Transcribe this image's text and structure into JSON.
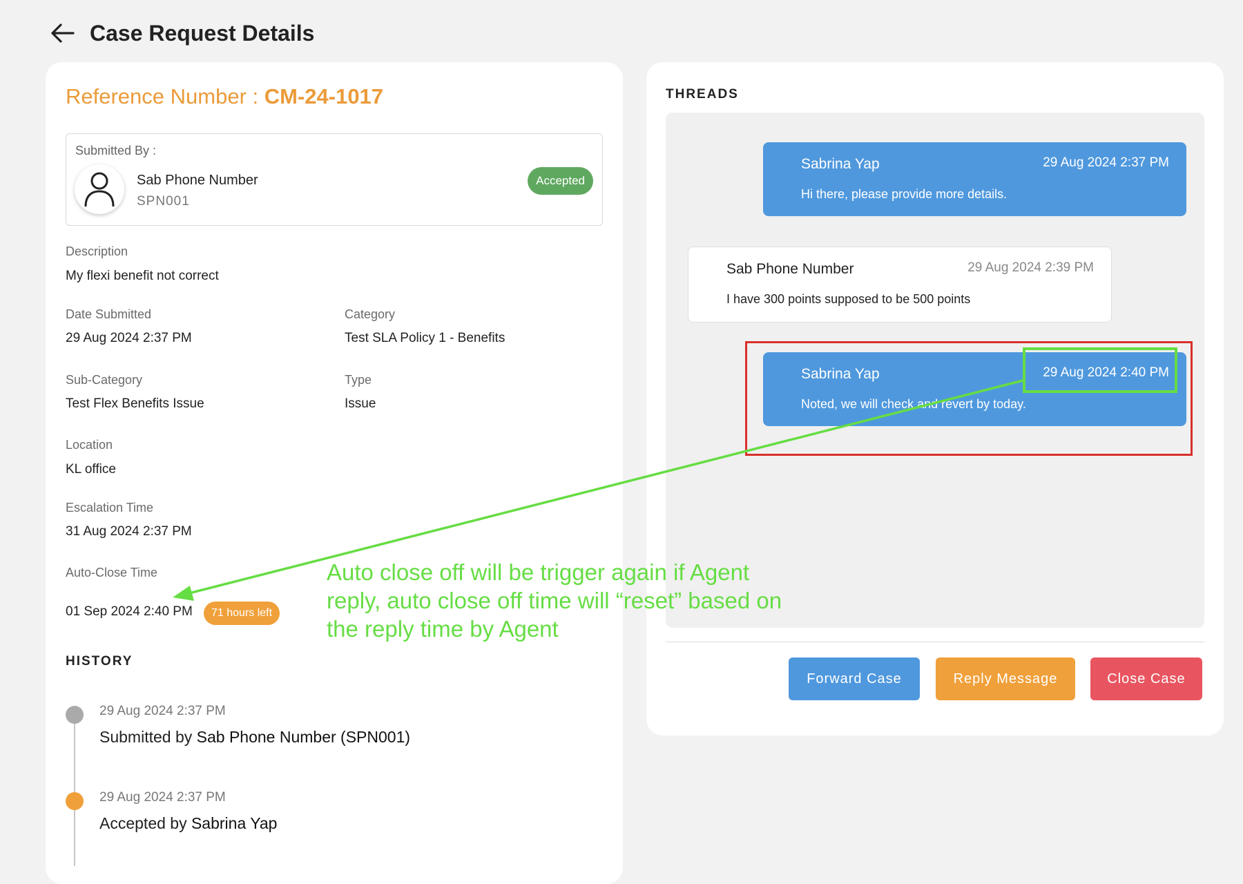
{
  "header": {
    "title": "Case Request Details"
  },
  "reference": {
    "label": "Reference Number : ",
    "number": "CM-24-1017"
  },
  "submitted_by": {
    "label": "Submitted By :",
    "name": "Sab Phone Number",
    "id": "SPN001",
    "status": "Accepted"
  },
  "details": {
    "description_label": "Description",
    "description": "My flexi benefit not correct",
    "date_submitted_label": "Date Submitted",
    "date_submitted": "29 Aug 2024 2:37 PM",
    "category_label": "Category",
    "category": "Test SLA Policy 1 - Benefits",
    "subcategory_label": "Sub-Category",
    "subcategory": "Test Flex Benefits Issue",
    "type_label": "Type",
    "type": "Issue",
    "location_label": "Location",
    "location": "KL office",
    "escalation_label": "Escalation Time",
    "escalation": "31 Aug 2024 2:37 PM",
    "autoclose_label": "Auto-Close Time",
    "autoclose": "01 Sep 2024 2:40 PM",
    "hours_left": "71 hours left"
  },
  "history": {
    "title": "HISTORY",
    "items": [
      {
        "date": "29 Aug 2024 2:37 PM",
        "prefix": "Submitted by ",
        "actor": "Sab Phone Number (SPN001)",
        "color": "#aaaaaa"
      },
      {
        "date": "29 Aug 2024 2:37 PM",
        "prefix": "Accepted by ",
        "actor": "Sabrina Yap",
        "color": "#f0a03a"
      }
    ]
  },
  "threads": {
    "title": "THREADS",
    "messages": [
      {
        "name": "Sabrina Yap",
        "time": "29 Aug 2024 2:37 PM",
        "body": "Hi there, please provide more details."
      },
      {
        "name": "Sab Phone Number",
        "time": "29 Aug 2024 2:39 PM",
        "body": "I have 300 points supposed to be 500 points"
      },
      {
        "name": "Sabrina Yap",
        "time": "29 Aug 2024 2:40 PM",
        "body": "Noted, we will check and revert by today."
      }
    ]
  },
  "actions": {
    "forward": "Forward Case",
    "reply": "Reply Message",
    "close": "Close Case"
  },
  "annotation": {
    "text": "Auto close off will be trigger again if Agent reply, auto close off time will “reset” based on the reply time by Agent"
  },
  "colors": {
    "accent_orange": "#eb9b3a",
    "agent_blue": "#4f98dd",
    "accepted_green": "#5fa860",
    "close_red": "#e85560",
    "annotation_green": "#66dd44",
    "highlight_red": "#d9302a"
  }
}
